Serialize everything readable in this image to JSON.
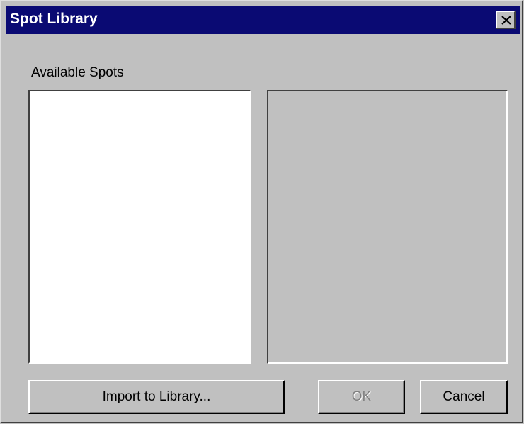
{
  "window": {
    "title": "Spot Library",
    "close_icon": "close-icon"
  },
  "main": {
    "available_label": "Available Spots",
    "available_items": []
  },
  "buttons": {
    "import_label": "Import to Library...",
    "ok_label": "OK",
    "cancel_label": "Cancel",
    "ok_enabled": false
  },
  "colors": {
    "titlebar": "#0a0a73",
    "face": "#c0c0c0"
  }
}
